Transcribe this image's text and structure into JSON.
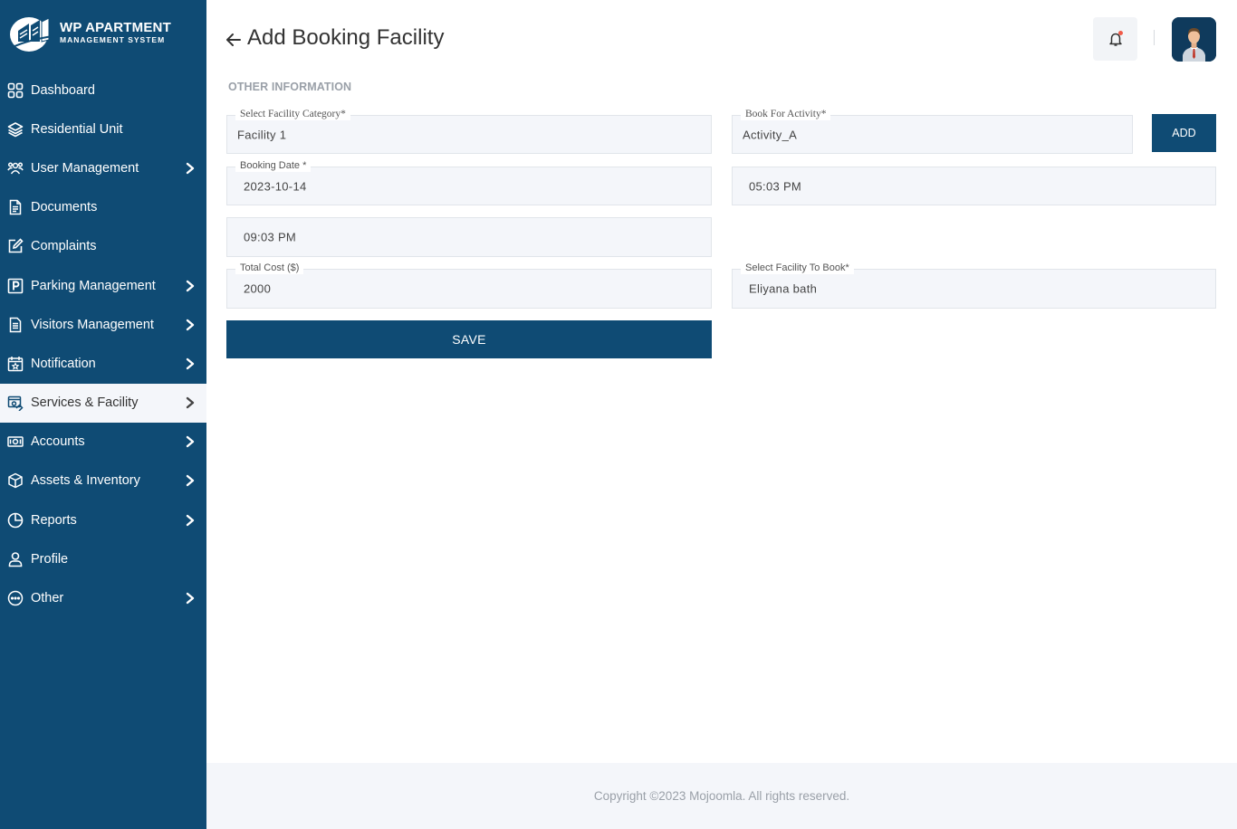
{
  "app": {
    "logo_title": "WP APARTMENT",
    "logo_subtitle": "MANAGEMENT SYSTEM"
  },
  "sidebar": {
    "items": [
      {
        "label": "Dashboard",
        "icon": "grid-icon",
        "chevron": false
      },
      {
        "label": "Residential Unit",
        "icon": "layers-icon",
        "chevron": false
      },
      {
        "label": "User Management",
        "icon": "users-icon",
        "chevron": true
      },
      {
        "label": "Documents",
        "icon": "document-icon",
        "chevron": false
      },
      {
        "label": "Complaints",
        "icon": "edit-icon",
        "chevron": false
      },
      {
        "label": "Parking Management",
        "icon": "parking-icon",
        "chevron": true
      },
      {
        "label": "Visitors Management",
        "icon": "clipboard-icon",
        "chevron": true
      },
      {
        "label": "Notification",
        "icon": "calendar-star-icon",
        "chevron": true
      },
      {
        "label": "Services & Facility",
        "icon": "services-icon",
        "chevron": true,
        "active": true
      },
      {
        "label": "Accounts",
        "icon": "money-icon",
        "chevron": true
      },
      {
        "label": "Assets & Inventory",
        "icon": "box-icon",
        "chevron": true
      },
      {
        "label": "Reports",
        "icon": "pie-chart-icon",
        "chevron": true
      },
      {
        "label": "Profile",
        "icon": "person-icon",
        "chevron": false
      },
      {
        "label": "Other",
        "icon": "more-icon",
        "chevron": true
      }
    ]
  },
  "header": {
    "title": "Add Booking Facility"
  },
  "form": {
    "section_title": "OTHER INFORMATION",
    "facility_category": {
      "label": "Select Facility Category*",
      "value": "Facility 1"
    },
    "activity": {
      "label": "Book For Activity*",
      "value": "Activity_A"
    },
    "add_label": "ADD",
    "booking_date": {
      "label": "Booking Date *",
      "value": "2023-10-14"
    },
    "start_time": {
      "value": "05:03 PM"
    },
    "end_time": {
      "value": "09:03 PM"
    },
    "total_cost": {
      "label": "Total Cost ($)",
      "value": "2000"
    },
    "facility_to_book": {
      "label": "Select Facility To Book*",
      "value": "Eliyana bath"
    },
    "save_label": "SAVE"
  },
  "footer": {
    "text": "Copyright ©2023 Mojoomla. All rights reserved."
  },
  "colors": {
    "sidebar_bg": "#0f4b74",
    "field_bg": "#f4f6fa",
    "notification_dot": "#f05a48"
  }
}
